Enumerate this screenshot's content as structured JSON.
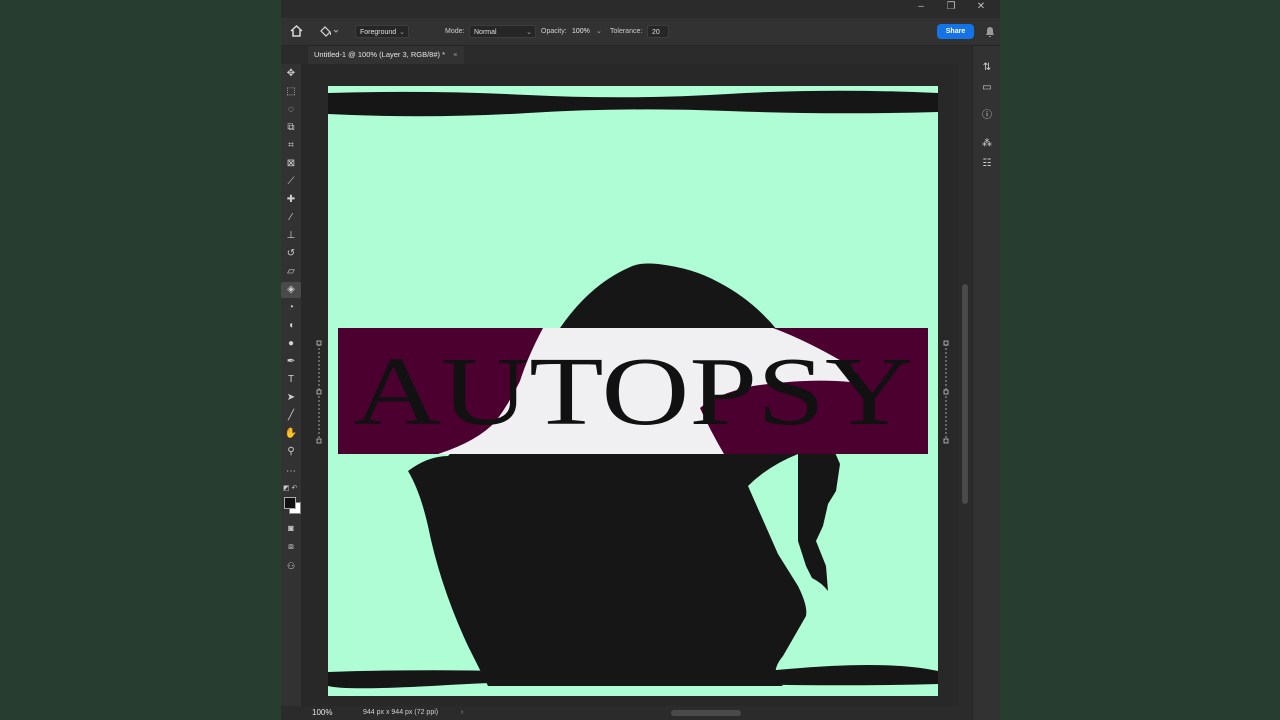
{
  "options": {
    "source_label": "Foreground",
    "mode_label": "Mode:",
    "mode_value": "Normal",
    "opacity_label": "Opacity:",
    "opacity_value": "100%",
    "tolerance_label": "Tolerance:",
    "tolerance_value": "20",
    "share_label": "Share"
  },
  "document_tab": {
    "title": "Untitled-1 @ 100% (Layer 3, RGB/8#) *",
    "close_glyph": "×"
  },
  "canvas": {
    "text": "AUTOPSY",
    "background_color": "#aefdd4",
    "band_color": "#4b0030",
    "silhouette_color": "#161616"
  },
  "status": {
    "zoom": "100%",
    "doc_size": "944 px x 944 px (72 ppi)"
  },
  "tools": [
    {
      "name": "move-tool",
      "glyph": "✥"
    },
    {
      "name": "marquee-tool",
      "glyph": "⬚"
    },
    {
      "name": "lasso-tool",
      "glyph": "◌"
    },
    {
      "name": "object-selection-tool",
      "glyph": "⧉"
    },
    {
      "name": "crop-tool",
      "glyph": "⌗"
    },
    {
      "name": "frame-tool",
      "glyph": "⊠"
    },
    {
      "name": "eyedropper-tool",
      "glyph": "⟋"
    },
    {
      "name": "healing-brush-tool",
      "glyph": "✚"
    },
    {
      "name": "brush-tool",
      "glyph": "⁄"
    },
    {
      "name": "clone-stamp-tool",
      "glyph": "⊥"
    },
    {
      "name": "history-brush-tool",
      "glyph": "↺"
    },
    {
      "name": "eraser-tool",
      "glyph": "▱"
    },
    {
      "name": "paint-bucket-tool",
      "glyph": "◈"
    },
    {
      "name": "blur-tool",
      "glyph": "◔"
    },
    {
      "name": "dodge-tool",
      "glyph": "◖"
    },
    {
      "name": "sponge-tool",
      "glyph": "●"
    },
    {
      "name": "pen-tool",
      "glyph": "✒"
    },
    {
      "name": "type-tool",
      "glyph": "T"
    },
    {
      "name": "path-selection-tool",
      "glyph": "➤"
    },
    {
      "name": "line-tool",
      "glyph": "╱"
    },
    {
      "name": "hand-tool",
      "glyph": "✋"
    },
    {
      "name": "zoom-tool",
      "glyph": "⚲"
    },
    {
      "name": "more-tools",
      "glyph": "⋯"
    }
  ],
  "right_panel": [
    {
      "name": "history-panel",
      "glyph": "⇅"
    },
    {
      "name": "comments-panel",
      "glyph": "▭"
    },
    {
      "name": "info-panel",
      "glyph": "ⓘ"
    },
    {
      "name": "brushes-panel",
      "glyph": "⁂"
    },
    {
      "name": "adjustments-panel",
      "glyph": "☷"
    }
  ]
}
